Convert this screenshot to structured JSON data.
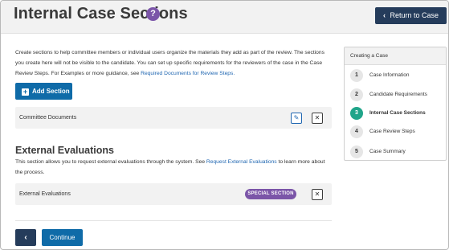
{
  "header": {
    "title": "Internal Case Sections",
    "help_icon": "?",
    "return_label": "Return to Case",
    "return_icon": "‹"
  },
  "intro": {
    "text": "Create sections to help committee members or individual users organize the materials they add as part of the review. The sections you create here will not be visible to the candidate. You can set up specific requirements for the reviewers of the case in the Case Review Steps. For Examples or more guidance, see ",
    "link": "Required Documents for Review Steps.",
    "add_section_label": "Add Section",
    "add_section_icon": "+"
  },
  "sections": [
    {
      "name": "Committee Documents",
      "edit_icon": "✎",
      "delete_icon": "✕"
    }
  ],
  "external": {
    "heading": "External Evaluations",
    "desc_before": "This section allows you to request external evaluations through the system. See ",
    "desc_link": "Request External Evaluations",
    "desc_after": " to learn more about the process.",
    "row_name": "External Evaluations",
    "badge": "SPECIAL SECTION",
    "delete_icon": "✕"
  },
  "footer": {
    "back_icon": "‹",
    "continue_label": "Continue"
  },
  "steps": {
    "title": "Creating a Case",
    "items": [
      {
        "num": "1",
        "label": "Case Information",
        "active": false
      },
      {
        "num": "2",
        "label": "Candidate Requirements",
        "active": false
      },
      {
        "num": "3",
        "label": "Internal Case Sections",
        "active": true
      },
      {
        "num": "4",
        "label": "Case Review Steps",
        "active": false
      },
      {
        "num": "5",
        "label": "Case Summary",
        "active": false
      }
    ]
  },
  "colors": {
    "navy": "#253c5b",
    "primary_blue": "#0f6ba8",
    "purple": "#7b55a8",
    "teal_active": "#20a58a",
    "link": "#1f66b1"
  }
}
